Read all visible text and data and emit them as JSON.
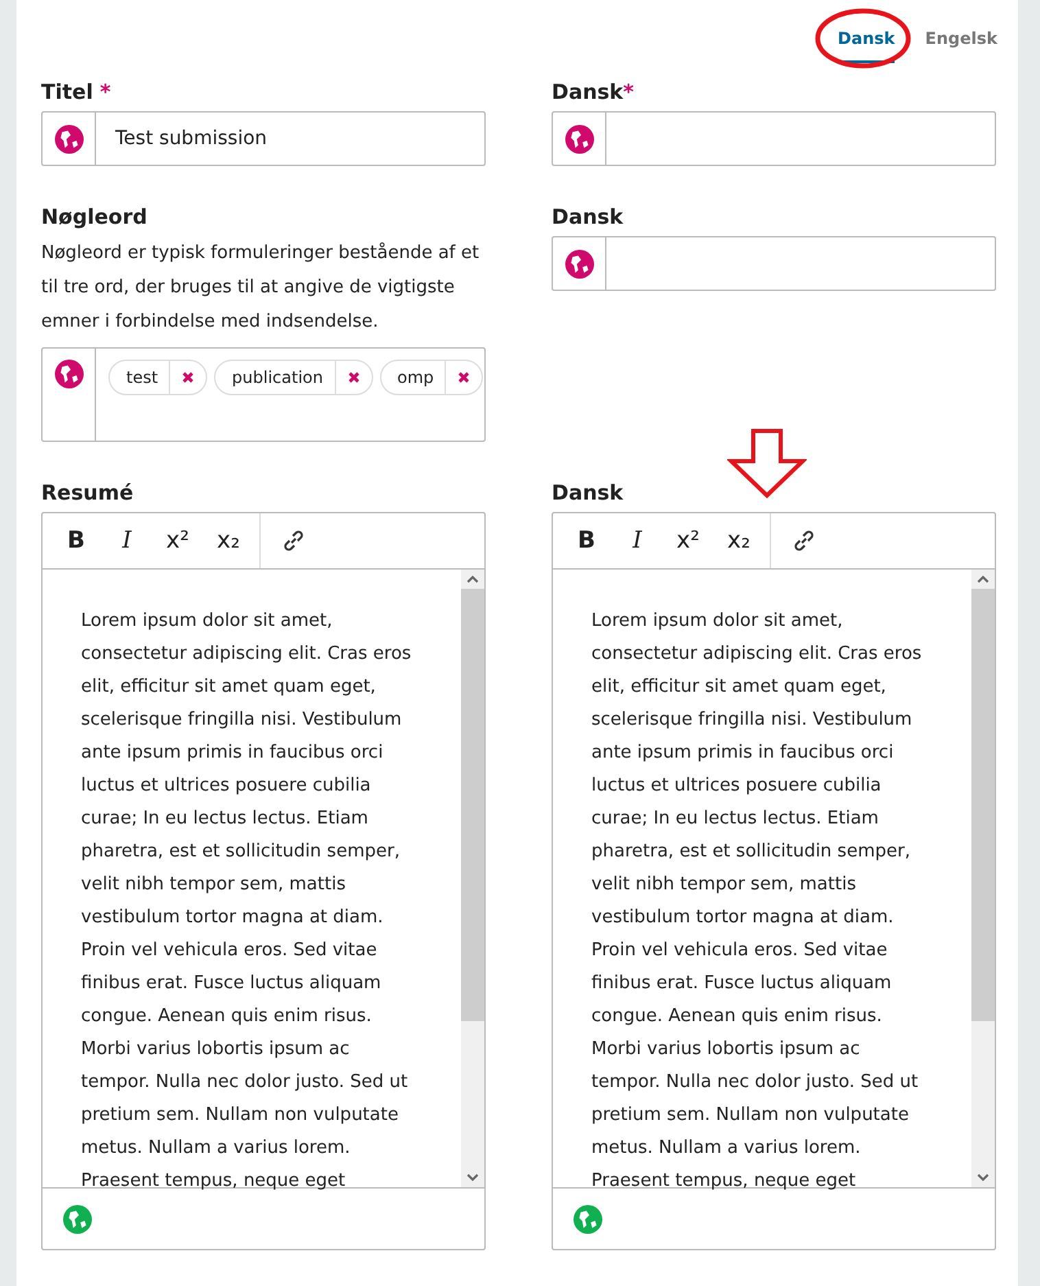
{
  "language_tabs": [
    {
      "label": "Dansk",
      "selected": true
    },
    {
      "label": "Engelsk",
      "selected": false
    }
  ],
  "title": {
    "label": "Titel",
    "required_mark": "*",
    "value": "Test submission",
    "translation": {
      "label": "Dansk",
      "required_mark": "*"
    }
  },
  "keywords": {
    "label": "Nøgleord",
    "description": "Nøgleord er typisk formuleringer bestående af et til tre ord, der bruges til at angive de vigtigste emner i forbindelse med indsendelse.",
    "tags": [
      "test",
      "publication",
      "omp"
    ],
    "translation": {
      "label": "Dansk"
    }
  },
  "abstract": {
    "label": "Resumé",
    "toolbar": [
      {
        "kind": "bold",
        "label": "B"
      },
      {
        "kind": "italic",
        "label": "I"
      },
      {
        "kind": "sup",
        "label": "x²"
      },
      {
        "kind": "sub",
        "label": "x₂"
      },
      {
        "kind": "link"
      }
    ],
    "text": "Lorem ipsum dolor sit amet, consectetur adipiscing elit. Cras eros elit, efficitur sit amet quam eget, scelerisque fringilla nisi. Vestibulum ante ipsum primis in faucibus orci luctus et ultrices posuere cubilia curae; In eu lectus lectus. Etiam pharetra, est et sollicitudin semper, velit nibh tempor sem, mattis vestibulum tortor magna at diam. Proin vel vehicula eros. Sed vitae finibus erat. Fusce luctus aliquam congue. Aenean quis enim risus. Morbi varius lobortis ipsum ac tempor. Nulla nec dolor justo. Sed ut pretium sem. Nullam non vulputate metus. Nullam a varius lorem. Praesent tempus, neque eget",
    "translation": {
      "label": "Dansk",
      "toolbar": [
        {
          "kind": "bold",
          "label": "B"
        },
        {
          "kind": "italic",
          "label": "I"
        },
        {
          "kind": "sup",
          "label": "x²"
        },
        {
          "kind": "sub",
          "label": "x₂"
        },
        {
          "kind": "link"
        }
      ],
      "text": "Lorem ipsum dolor sit amet, consectetur adipiscing elit. Cras eros elit, efficitur sit amet quam eget, scelerisque fringilla nisi. Vestibulum ante ipsum primis in faucibus orci luctus et ultrices posuere cubilia curae; In eu lectus lectus. Etiam pharetra, est et sollicitudin semper, velit nibh tempor sem, mattis vestibulum tortor magna at diam. Proin vel vehicula eros. Sed vitae finibus erat. Fusce luctus aliquam congue. Aenean quis enim risus. Morbi varius lobortis ipsum ac tempor. Nulla nec dolor justo. Sed ut pretium sem. Nullam non vulputate metus. Nullam a varius lorem. Praesent tempus, neque eget"
    }
  }
}
